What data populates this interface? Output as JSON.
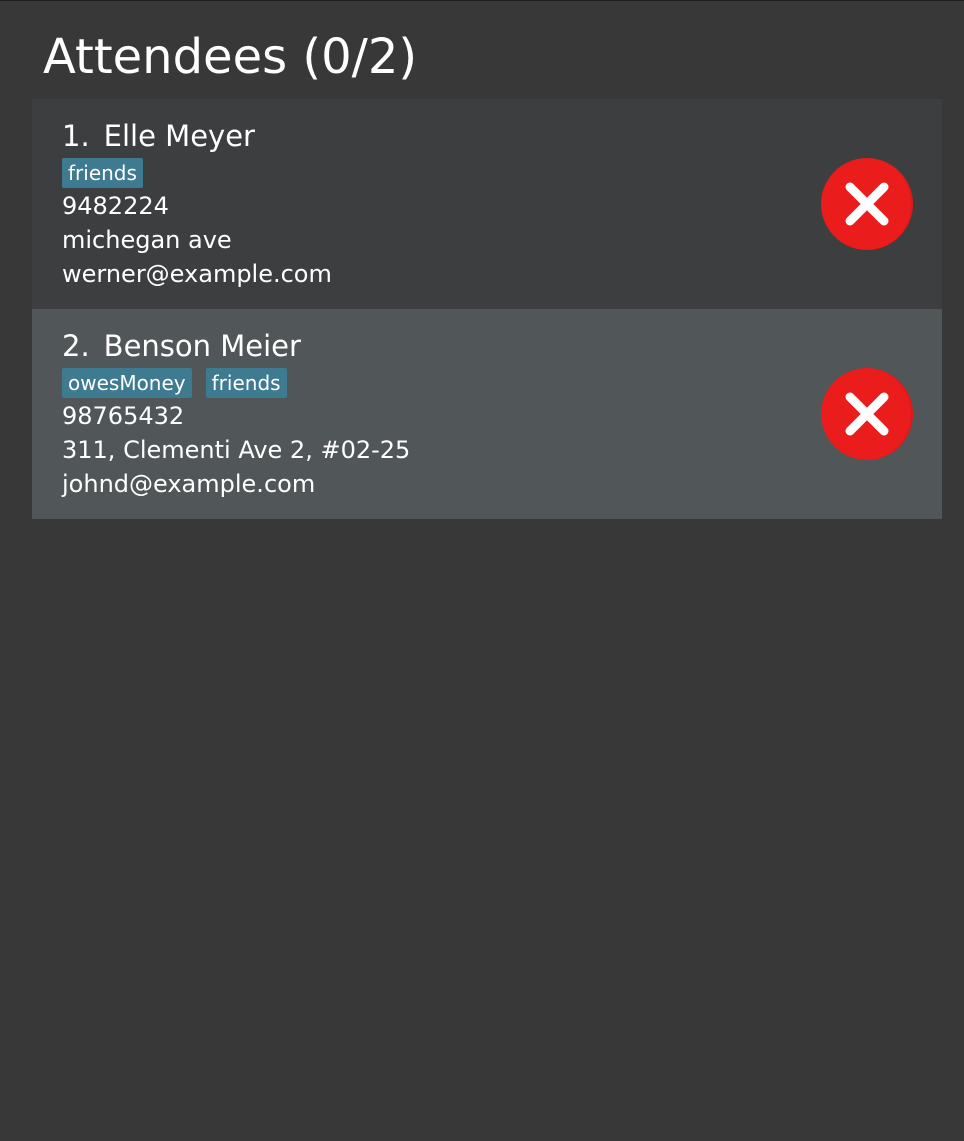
{
  "header": {
    "title": "Attendees (0/2)"
  },
  "colors": {
    "background": "#383838",
    "card_odd": "#3c3e3f",
    "card_even": "#515658",
    "tag": "#3e7b91",
    "remove_red": "#ea1c1c"
  },
  "attendees": [
    {
      "index": "1.",
      "name": "Elle Meyer",
      "tags": [
        "friends"
      ],
      "phone": "9482224",
      "address": "michegan ave",
      "email": "werner@example.com",
      "remove_icon": "close-circle-icon"
    },
    {
      "index": "2.",
      "name": "Benson Meier",
      "tags": [
        "owesMoney",
        "friends"
      ],
      "phone": "98765432",
      "address": "311, Clementi Ave 2, #02-25",
      "email": "johnd@example.com",
      "remove_icon": "close-circle-icon"
    }
  ]
}
